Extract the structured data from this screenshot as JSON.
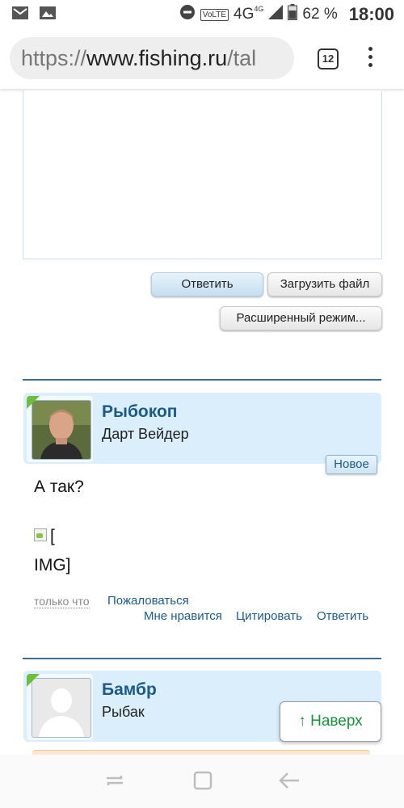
{
  "status_bar": {
    "left_icons": [
      "gmail-icon",
      "image-icon"
    ],
    "network_label": "VoLTE",
    "network_type": "4G",
    "network_type_small": "4G",
    "battery_percent": "62 %",
    "time": "18:00"
  },
  "browser": {
    "url_prefix": "https://",
    "url_domain": "www.fishing.ru",
    "url_rest": "/tal",
    "tab_count": "12"
  },
  "editor": {
    "reply_button": "Ответить",
    "upload_button": "Загрузить файл",
    "advanced_button": "Расширенный режим..."
  },
  "posts": [
    {
      "username": "Рыбокоп",
      "user_title": "Дарт Вейдер",
      "badge": "Новое",
      "message": "А так?",
      "image_bracket": "[",
      "image_label": "IMG]",
      "time": "только что",
      "report_link": "Пожаловаться",
      "actions": [
        "Мне нравится",
        "Цитировать",
        "Ответить"
      ]
    },
    {
      "username": "Бамбр",
      "user_title": "Рыбак"
    }
  ],
  "scroll_top_button": "↑ Наверх",
  "colors": {
    "accent_blue": "#1c5a8a",
    "post_header_bg": "#dbeefb",
    "online_green": "#6cbf3e",
    "scroll_top_green": "#1a8f3c"
  }
}
